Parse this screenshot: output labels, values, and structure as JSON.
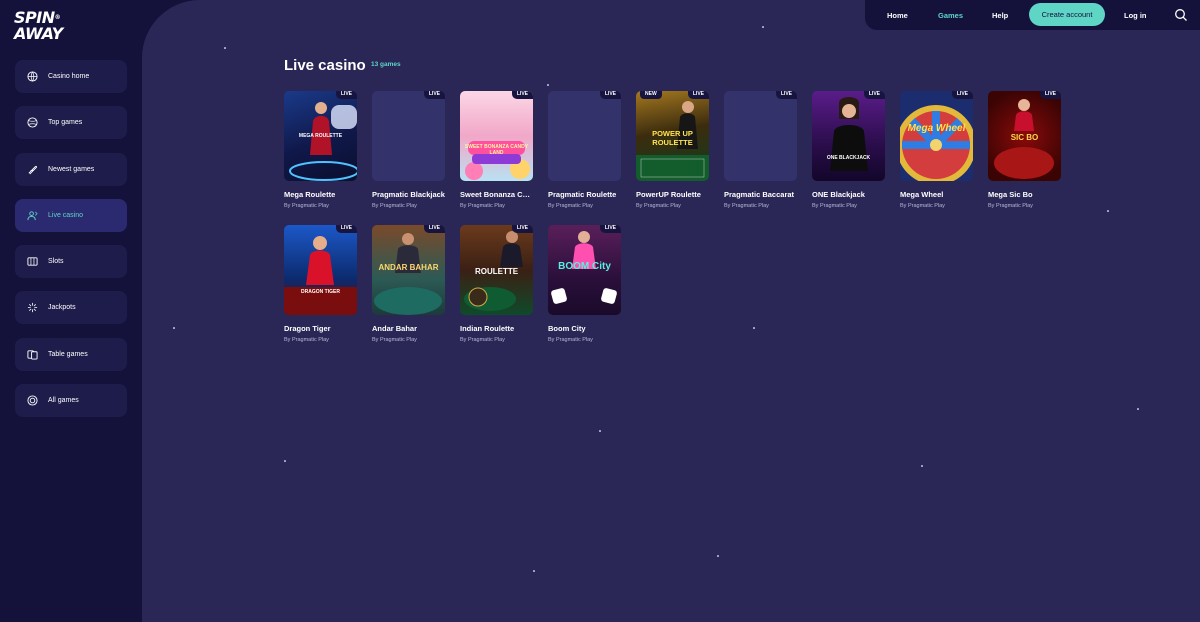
{
  "brand": {
    "logo_text": "SPIN",
    "logo_text2": "AWAY",
    "logo_mark": "®"
  },
  "sidebar": {
    "items": [
      {
        "label": "Casino home",
        "icon": "globe-icon"
      },
      {
        "label": "Top games",
        "icon": "globe-icon"
      },
      {
        "label": "Newest games",
        "icon": "feather-icon"
      },
      {
        "label": "Live casino",
        "icon": "dealer-icon",
        "active": true
      },
      {
        "label": "Slots",
        "icon": "slots-icon"
      },
      {
        "label": "Jackpots",
        "icon": "sparkle-icon"
      },
      {
        "label": "Table games",
        "icon": "cards-icon"
      },
      {
        "label": "All games",
        "icon": "target-icon"
      }
    ]
  },
  "topnav": {
    "home": "Home",
    "games": "Games",
    "help": "Help",
    "create_account": "Create account",
    "login": "Log in"
  },
  "page": {
    "title": "Live casino",
    "count": "13 games"
  },
  "games": [
    {
      "title": "Mega Roulette",
      "provider": "By Pragmatic Play",
      "badge": "LIVE",
      "thumb_label": "MEGA ROULETTE"
    },
    {
      "title": "Pragmatic Blackjack",
      "provider": "By Pragmatic Play",
      "badge": "LIVE"
    },
    {
      "title": "Sweet Bonanza CandyLand",
      "provider": "By Pragmatic Play",
      "badge": "LIVE",
      "thumb_label": "SWEET BONANZA CANDY LAND"
    },
    {
      "title": "Pragmatic Roulette",
      "provider": "By Pragmatic Play",
      "badge": "LIVE"
    },
    {
      "title": "PowerUP Roulette",
      "provider": "By Pragmatic Play",
      "badge": "LIVE",
      "new_badge": "NEW",
      "thumb_label": "POWER UP ROULETTE"
    },
    {
      "title": "Pragmatic Baccarat",
      "provider": "By Pragmatic Play",
      "badge": "LIVE"
    },
    {
      "title": "ONE Blackjack",
      "provider": "By Pragmatic Play",
      "badge": "LIVE",
      "thumb_label": "ONE BLACKJACK"
    },
    {
      "title": "Mega Wheel",
      "provider": "By Pragmatic Play",
      "badge": "LIVE",
      "thumb_label": "Mega Wheel"
    },
    {
      "title": "Mega Sic Bo",
      "provider": "By Pragmatic Play",
      "badge": "LIVE",
      "thumb_label": "SIC BO"
    },
    {
      "title": "Dragon Tiger",
      "provider": "By Pragmatic Play",
      "badge": "LIVE",
      "thumb_label": "DRAGON TIGER"
    },
    {
      "title": "Andar Bahar",
      "provider": "By Pragmatic Play",
      "badge": "LIVE",
      "thumb_label": "ANDAR BAHAR"
    },
    {
      "title": "Indian Roulette",
      "provider": "By Pragmatic Play",
      "badge": "LIVE",
      "thumb_label": "ROULETTE"
    },
    {
      "title": "Boom City",
      "provider": "By Pragmatic Play",
      "badge": "LIVE",
      "thumb_label": "BOOM City"
    }
  ],
  "colors": {
    "accent": "#5fd5c6",
    "sidebar_bg": "#14123b",
    "main_bg": "#2a2756",
    "card_bg": "#1e1c4b"
  }
}
